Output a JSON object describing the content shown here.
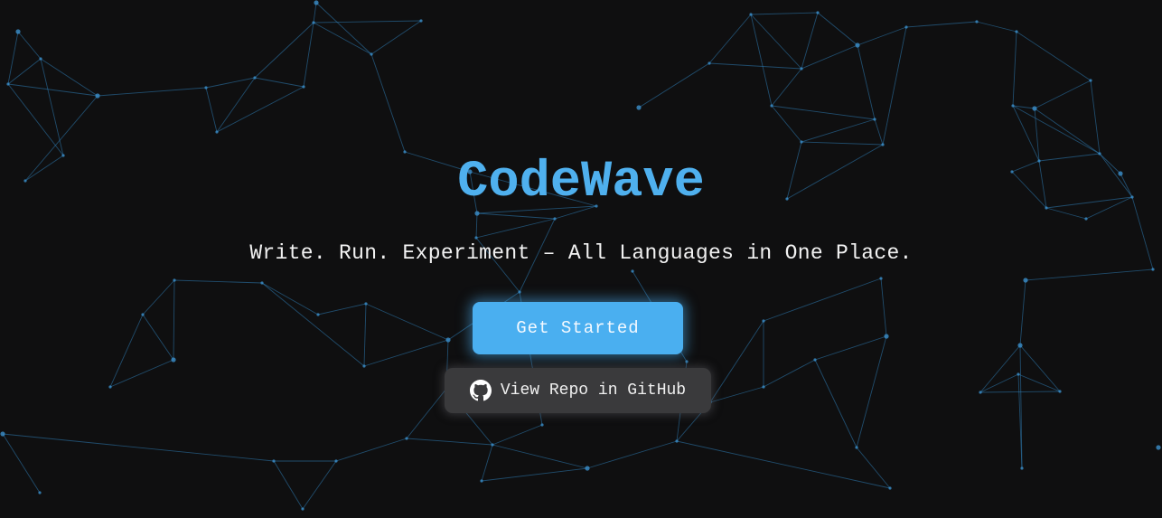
{
  "hero": {
    "title": "CodeWave",
    "tagline": "Write. Run. Experiment – All Languages in One Place.",
    "primary_button": "Get Started",
    "github_button": "View Repo in GitHub",
    "github_icon": "github-icon",
    "background": "network-lines-animation"
  },
  "colors": {
    "background": "#0f0f10",
    "accent": "#4aaff0",
    "title": "#4fb0ee",
    "network_line": "#2f7fb8",
    "secondary_button": "#3a3a3c",
    "text": "#f2f2f2"
  }
}
